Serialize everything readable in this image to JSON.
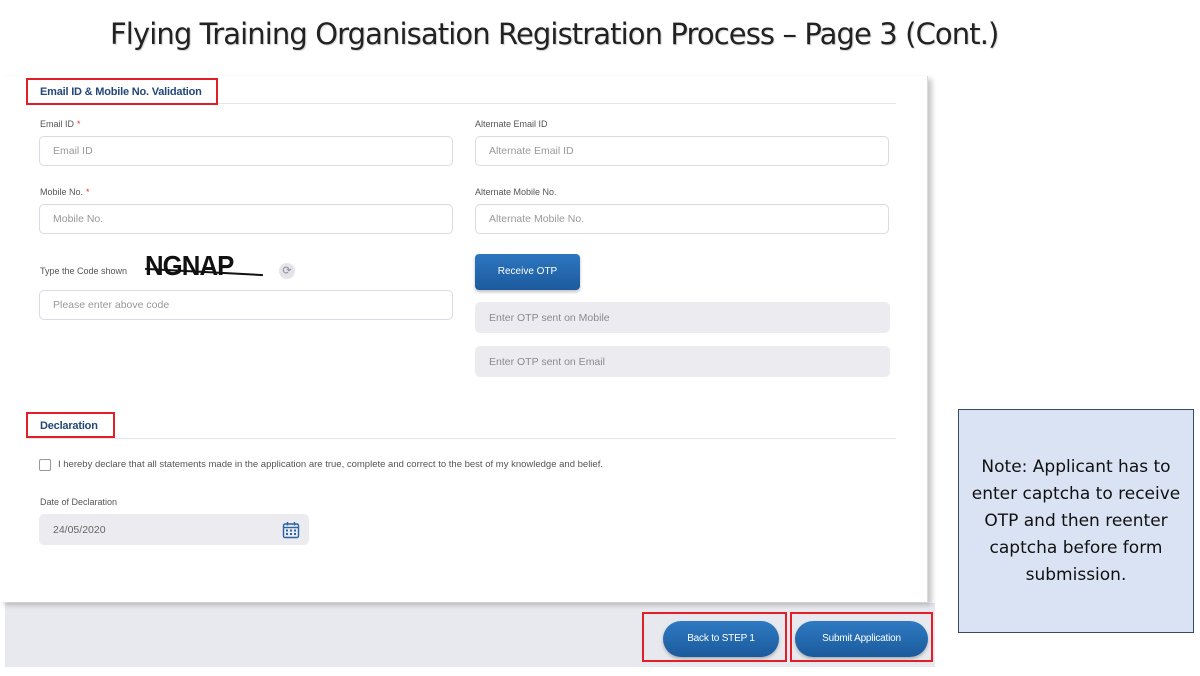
{
  "slide": {
    "title": "Flying Training Organisation Registration Process – Page 3 (Cont.)"
  },
  "email_section": {
    "title": "Email ID & Mobile No. Validation",
    "email": {
      "label": "Email ID",
      "required_mark": "*",
      "placeholder": "Email ID"
    },
    "alt_email": {
      "label": "Alternate Email ID",
      "placeholder": "Alternate Email ID"
    },
    "mobile": {
      "label": "Mobile No.",
      "required_mark": "*",
      "placeholder": "Mobile No."
    },
    "alt_mobile": {
      "label": "Alternate Mobile No.",
      "placeholder": "Alternate Mobile No."
    },
    "captcha": {
      "label": "Type the Code shown",
      "code": "NGNAP",
      "placeholder": "Please enter above code",
      "refresh_icon": "refresh-icon"
    },
    "receive_otp_label": "Receive OTP",
    "otp_mobile_placeholder": "Enter OTP sent on Mobile",
    "otp_email_placeholder": "Enter OTP sent on Email"
  },
  "declaration_section": {
    "title": "Declaration",
    "checkbox_checked": false,
    "statement": "I hereby declare that all statements made in the application are true, complete and correct to the best of my knowledge and belief.",
    "date_label": "Date of Declaration",
    "date_value": "24/05/2020",
    "calendar_icon": "calendar-icon"
  },
  "actions": {
    "back_label": "Back to STEP 1",
    "submit_label": "Submit Application"
  },
  "note": {
    "text": "Note: Applicant has to enter captcha to receive OTP and then reenter captcha before form submission."
  },
  "colors": {
    "accent_blue": "#1f5fa3",
    "highlight_red": "#e21f26",
    "note_background": "#dae3f3"
  }
}
